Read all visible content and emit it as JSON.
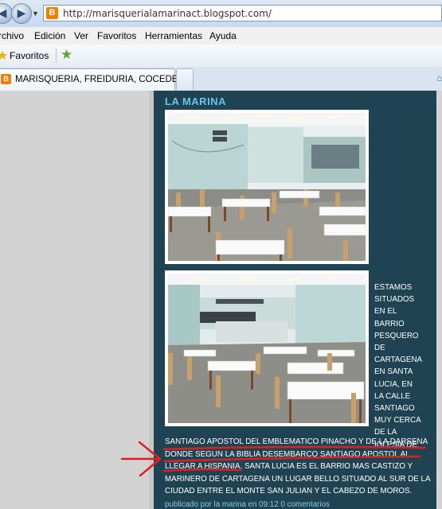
{
  "browser": {
    "url": "http://marisquerialamarinact.blogspot.com/",
    "menu": [
      "rchivo",
      "Edición",
      "Ver",
      "Favoritos",
      "Herramientas",
      "Ayuda"
    ],
    "favorites_label": "Favoritos",
    "tab_title": "MARISQUERIA, FREIDURIA, COCEDER..."
  },
  "post": {
    "title": "LA MARINA",
    "side_lines": [
      "ESTAMOS",
      "SITUADOS",
      "EN EL",
      "BARRIO",
      "PESQUERO",
      "DE",
      "CARTAGENA",
      "EN SANTA",
      "LUCIA, EN",
      "LA CALLE",
      "SANTIAGO",
      "MUY CERCA",
      "DE LA",
      "IGLESIA DE"
    ],
    "body_lines": [
      "SANTIAGO APOSTOL DEL EMBLEMATICO PINACHO Y DE LA DARSENA",
      "DONDE SEGUN LA BIBLIA DESEMBARCO SANTIAGO APOSTOL AL",
      "LLEGAR A HISPANIA. SANTA LUCIA ES EL BARRIO MAS CASTIZO Y",
      "MARINERO DE CARTAGENA UN LUGAR BELLO SITUADO AL SUR DE LA",
      "CIUDAD ENTRE EL MONTE SAN JULIAN Y EL CABEZO DE MOROS."
    ],
    "footer": "publicado por la marina en 09:12 0 comentarios"
  },
  "colors": {
    "post_background": "#1f4352",
    "title": "#69c6e8",
    "annotation": "#e02020"
  }
}
